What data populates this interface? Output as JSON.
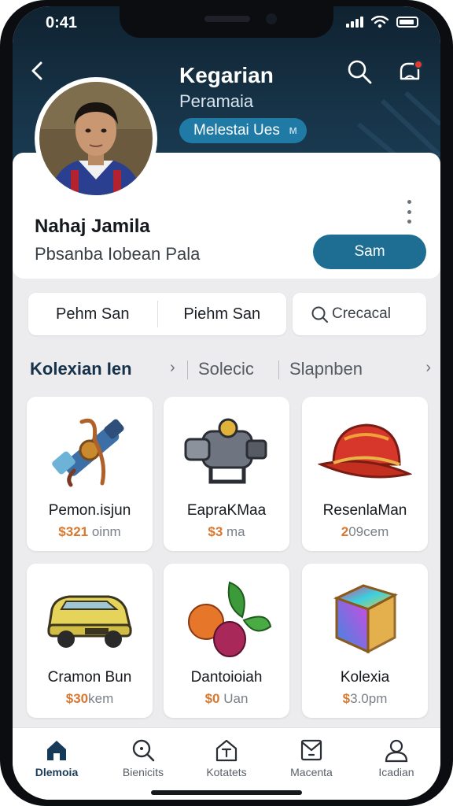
{
  "status_bar": {
    "time": "0:41"
  },
  "header": {
    "title": "Kegarian",
    "subtitle": "Peramaia",
    "badge_label": "Melestai Ues",
    "badge_suffix": "ᴍ"
  },
  "profile": {
    "name": "Nahaj Jamila",
    "subtitle": "Pbsanba Iobean Pala",
    "action_button": "Sam"
  },
  "filters": {
    "segments": [
      "Pehm San",
      "Piehm San"
    ],
    "search_placeholder": "Crecacal"
  },
  "categories": {
    "active": "Kolexian Ien",
    "active_chevron": "›",
    "items": [
      "Solecic",
      "Slapnben"
    ],
    "more_chevron": "›"
  },
  "products": [
    {
      "name": "Pemon.isjun",
      "price": "$321",
      "price_suffix": "oinm",
      "icon": "cannon-icon"
    },
    {
      "name": "EapraKMaa",
      "price": "$3",
      "price_suffix": "ma",
      "icon": "gear-cannon-icon"
    },
    {
      "name": "ResenlaMan",
      "price": "2",
      "price_suffix": "09cem",
      "icon": "helmet-icon"
    },
    {
      "name": "Cramon Bun",
      "price": "$30",
      "price_suffix": "kem",
      "icon": "car-icon"
    },
    {
      "name": "Dantoioiah",
      "price": "$0",
      "price_suffix": "Uan",
      "icon": "fruit-icon"
    },
    {
      "name": "Kolexia",
      "price": "$",
      "price_suffix": "3.0pm",
      "icon": "gem-cube-icon"
    }
  ],
  "bottom_nav": [
    {
      "label": "Dlemoia",
      "icon": "home-icon",
      "active": true
    },
    {
      "label": "Bienicits",
      "icon": "search-icon",
      "active": false
    },
    {
      "label": "Kotatets",
      "icon": "house-outline-icon",
      "active": false
    },
    {
      "label": "Macenta",
      "icon": "mail-icon",
      "active": false
    },
    {
      "label": "Icadian",
      "icon": "profile-icon",
      "active": false
    }
  ],
  "colors": {
    "header_bg": "#163246",
    "accent": "#1d6e92",
    "badge": "#1f7aa6",
    "price_orange": "#d9782f",
    "notification": "#e23b2e"
  }
}
